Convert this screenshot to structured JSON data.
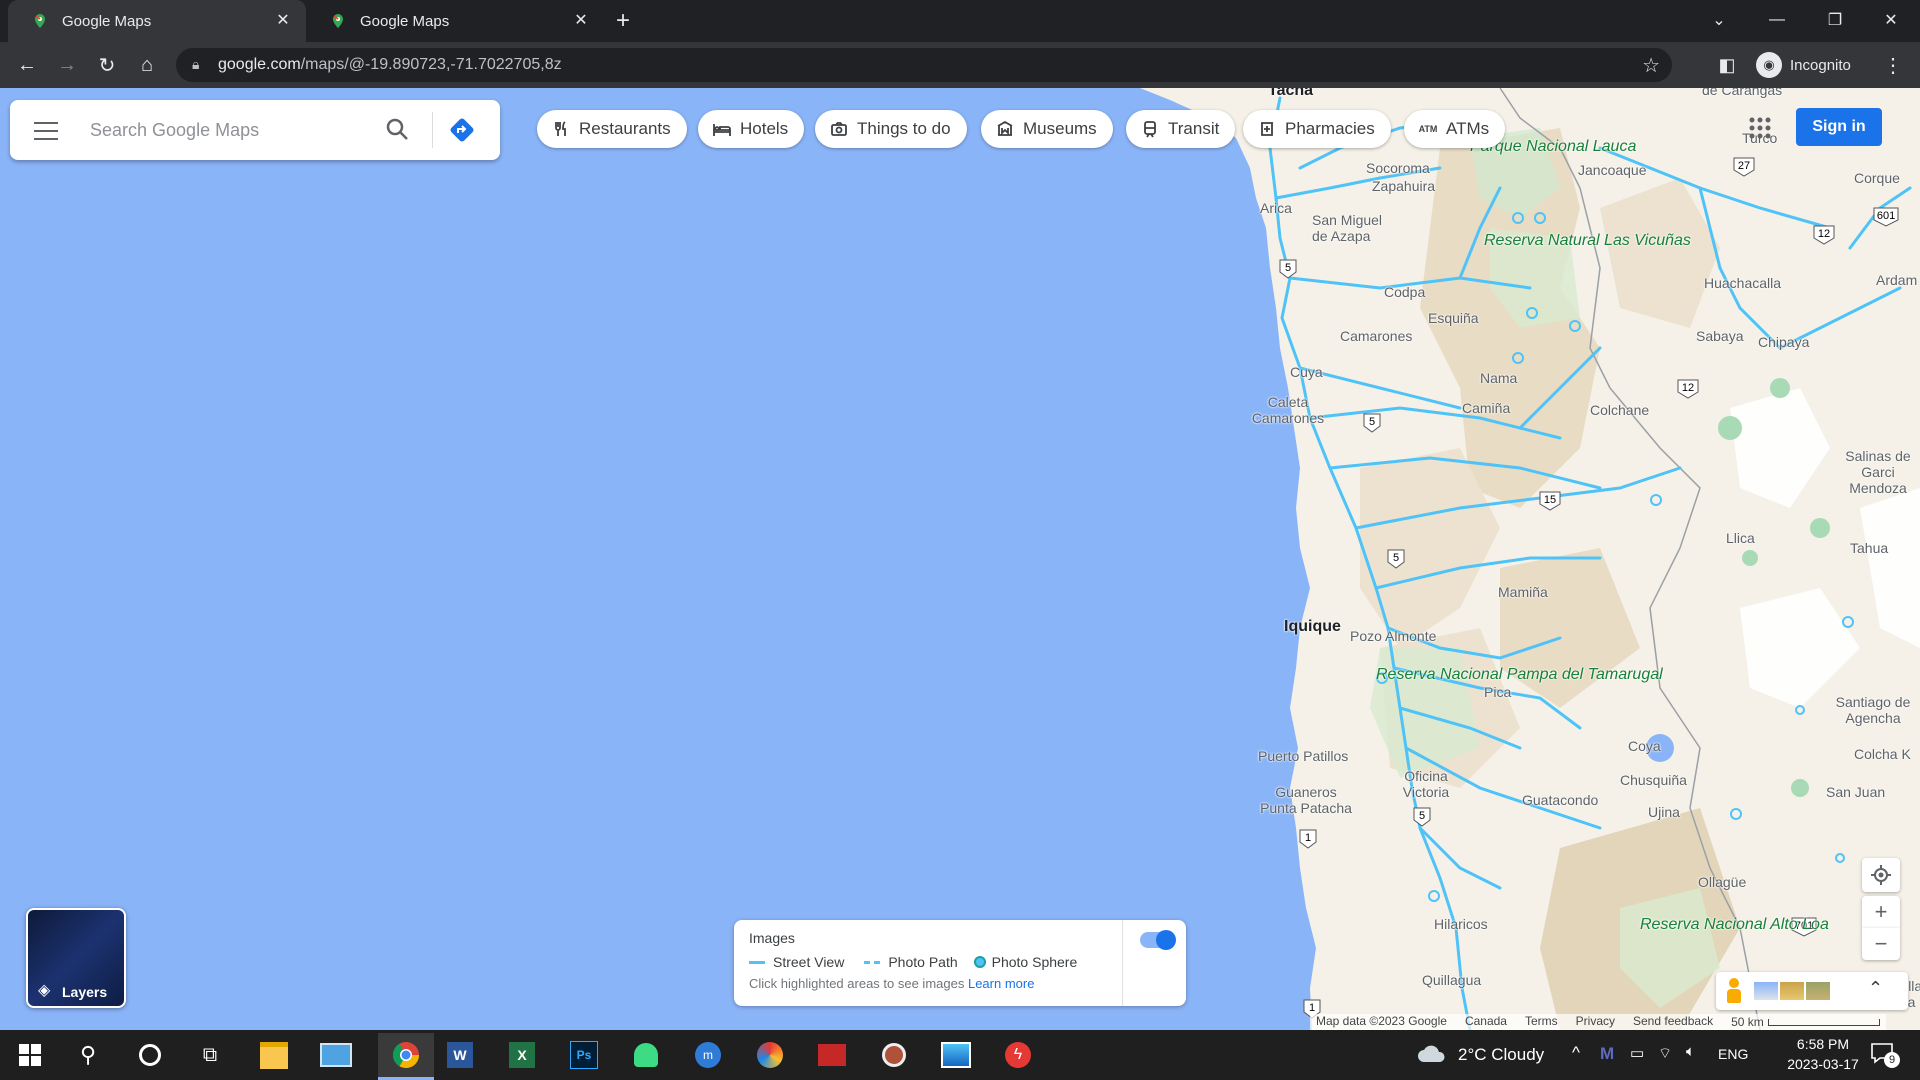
{
  "browser": {
    "tabs": [
      {
        "title": "Google Maps",
        "active": true
      },
      {
        "title": "Google Maps",
        "active": false
      }
    ],
    "url_host": "google.com",
    "url_path": "/maps/@-19.890723,-71.7022705,8z",
    "profile_label": "Incognito",
    "colors": {
      "tabbar": "#202124",
      "toolbar": "#35363a"
    }
  },
  "maps": {
    "search_placeholder": "Search Google Maps",
    "chips": [
      {
        "label": "Restaurants",
        "icon": "fork-knife-icon"
      },
      {
        "label": "Hotels",
        "icon": "bed-icon"
      },
      {
        "label": "Things to do",
        "icon": "camera-icon"
      },
      {
        "label": "Museums",
        "icon": "museum-icon"
      },
      {
        "label": "Transit",
        "icon": "train-icon"
      },
      {
        "label": "Pharmacies",
        "icon": "pharmacy-icon"
      },
      {
        "label": "ATMs",
        "icon": "atm-icon"
      }
    ],
    "sign_in": "Sign in",
    "layers_label": "Layers",
    "images_panel": {
      "title": "Images",
      "legend": [
        "Street View",
        "Photo Path",
        "Photo Sphere"
      ],
      "hint": "Click highlighted areas to see images",
      "learn_more": "Learn more",
      "toggle_on": true
    },
    "footer": [
      "Map data ©2023 Google",
      "Canada",
      "Terms",
      "Privacy",
      "Send feedback",
      "50 km"
    ],
    "places": [
      {
        "name": "Tacna",
        "type": "city"
      },
      {
        "name": "de Carangas",
        "type": "town"
      },
      {
        "name": "Turco",
        "type": "town"
      },
      {
        "name": "Parque Nacional Lauca",
        "type": "park"
      },
      {
        "name": "Jancoaque",
        "type": "town"
      },
      {
        "name": "Corque",
        "type": "town"
      },
      {
        "name": "Socoroma",
        "type": "town"
      },
      {
        "name": "Zapahuira",
        "type": "town"
      },
      {
        "name": "Arica",
        "type": "town"
      },
      {
        "name": "San Miguel de Azapa",
        "type": "town"
      },
      {
        "name": "Reserva Natural Las Vicuñas",
        "type": "park"
      },
      {
        "name": "Huachacalla",
        "type": "town"
      },
      {
        "name": "Ardam",
        "type": "town"
      },
      {
        "name": "Codpa",
        "type": "town"
      },
      {
        "name": "Esquiña",
        "type": "town"
      },
      {
        "name": "Sabaya",
        "type": "town"
      },
      {
        "name": "Chipaya",
        "type": "town"
      },
      {
        "name": "Camarones",
        "type": "town"
      },
      {
        "name": "Cuya",
        "type": "town"
      },
      {
        "name": "Nama",
        "type": "town"
      },
      {
        "name": "Caleta Camarones",
        "type": "town"
      },
      {
        "name": "Camiña",
        "type": "town"
      },
      {
        "name": "Colchane",
        "type": "town"
      },
      {
        "name": "Salinas de Garci Mendoza",
        "type": "town"
      },
      {
        "name": "Llica",
        "type": "town"
      },
      {
        "name": "Tahua",
        "type": "town"
      },
      {
        "name": "Mamiña",
        "type": "town"
      },
      {
        "name": "Iquique",
        "type": "city"
      },
      {
        "name": "Pozo Almonte",
        "type": "town"
      },
      {
        "name": "Reserva Nacional Pampa del Tamarugal",
        "type": "park"
      },
      {
        "name": "Pica",
        "type": "town"
      },
      {
        "name": "Santiago de Agencha",
        "type": "town"
      },
      {
        "name": "Coya",
        "type": "town"
      },
      {
        "name": "Colcha K",
        "type": "town"
      },
      {
        "name": "Puerto Patillos",
        "type": "town"
      },
      {
        "name": "Oficina Victoria",
        "type": "town"
      },
      {
        "name": "Chusquiña",
        "type": "town"
      },
      {
        "name": "Guaneros Punta Patacha",
        "type": "town"
      },
      {
        "name": "Guatacondo",
        "type": "town"
      },
      {
        "name": "Ujina",
        "type": "town"
      },
      {
        "name": "San Juan",
        "type": "town"
      },
      {
        "name": "Ollagüe",
        "type": "town"
      },
      {
        "name": "Hilaricos",
        "type": "town"
      },
      {
        "name": "Reserva Nacional Alto Loa",
        "type": "park"
      },
      {
        "name": "Quillagua",
        "type": "town"
      },
      {
        "name": "Villa Ma",
        "type": "town"
      }
    ],
    "route_shields": [
      "5",
      "5",
      "5",
      "15",
      "12",
      "12",
      "27",
      "601",
      "1",
      "5",
      "701",
      "1"
    ],
    "colors": {
      "water": "#8ab4f8",
      "land": "#f5f1e8",
      "desert": "#e8dcc4",
      "park": "#cfe8cf",
      "coverage": "#4fc3f7",
      "accent": "#1a73e8"
    }
  },
  "taskbar": {
    "weather": "2°C  Cloudy",
    "lang": "ENG",
    "time": "6:58 PM",
    "date": "2023-03-17",
    "notifications": "9"
  }
}
